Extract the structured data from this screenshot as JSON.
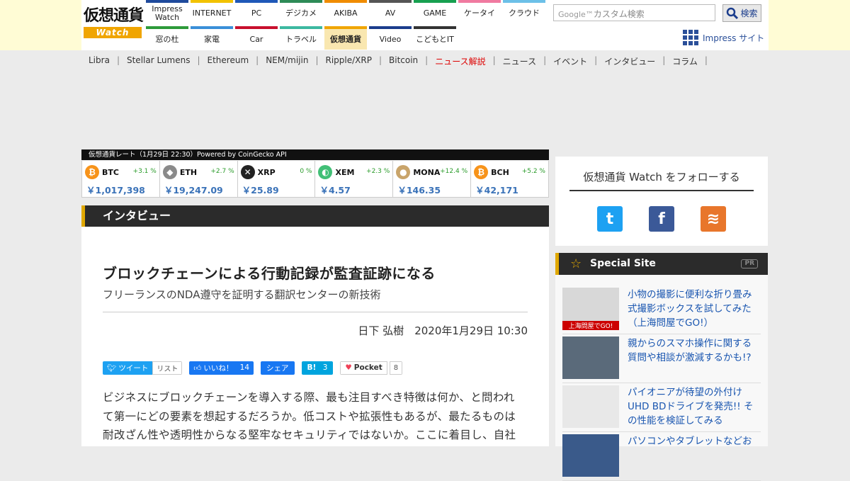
{
  "header": {
    "logo_text": "仮想通貨",
    "logo_sub": "Watch",
    "nav_row1": [
      {
        "label": "Impress Watch",
        "color": "#1f4a9c"
      },
      {
        "label": "INTERNET",
        "color": "#f2c200"
      },
      {
        "label": "PC",
        "color": "#1f58b8"
      },
      {
        "label": "デジカメ",
        "color": "#2e8b57"
      },
      {
        "label": "AKIBA",
        "color": "#f08c00"
      },
      {
        "label": "AV",
        "color": "#555555"
      },
      {
        "label": "GAME",
        "color": "#17a050"
      },
      {
        "label": "ケータイ",
        "color": "#f07aa0"
      },
      {
        "label": "クラウド",
        "color": "#6cc0e8"
      }
    ],
    "nav_row2": [
      {
        "label": "窓の杜",
        "color": "#2e9a3a"
      },
      {
        "label": "家電",
        "color": "#3a8fd8"
      },
      {
        "label": "Car",
        "color": "#c8102e"
      },
      {
        "label": "トラベル",
        "color": "#3cb8a0"
      },
      {
        "label": "仮想通貨",
        "color": "#f0a500",
        "active": true
      },
      {
        "label": "Video",
        "color": "#1a3c8c"
      },
      {
        "label": "こどもとIT",
        "color": "#333333"
      }
    ],
    "search_placeholder": "カスタム検索",
    "search_brand": "Google™",
    "search_button": "検索",
    "impress_site": "Impress サイト"
  },
  "subnav": [
    {
      "label": "Libra"
    },
    {
      "label": "Stellar Lumens"
    },
    {
      "label": "Ethereum"
    },
    {
      "label": "NEM/mijin"
    },
    {
      "label": "Ripple/XRP"
    },
    {
      "label": "Bitcoin"
    },
    {
      "label": "ニュース解説",
      "highlight": true
    },
    {
      "label": "ニュース"
    },
    {
      "label": "イベント"
    },
    {
      "label": "インタビュー"
    },
    {
      "label": "コラム"
    }
  ],
  "rates": {
    "header": "仮想通貨レート（1月29日 22:30）Powered by CoinGecko API",
    "coins": [
      {
        "symbol": "BTC",
        "change": "+3.1 %",
        "price": "￥1,017,398",
        "icon": "bitcoin-icon",
        "color": "#f7931a",
        "glyph": "₿"
      },
      {
        "symbol": "ETH",
        "change": "+2.7 %",
        "price": "￥19,247.09",
        "icon": "ethereum-icon",
        "color": "#8a8a8a",
        "glyph": "◆"
      },
      {
        "symbol": "XRP",
        "change": "0 %",
        "price": "￥25.89",
        "icon": "ripple-icon",
        "color": "#222222",
        "glyph": "✕"
      },
      {
        "symbol": "XEM",
        "change": "+2.3 %",
        "price": "￥4.57",
        "icon": "nem-icon",
        "color": "#41bf76",
        "glyph": "◐"
      },
      {
        "symbol": "MONA",
        "change": "+12.4 %",
        "price": "￥146.35",
        "icon": "monacoin-icon",
        "color": "#c9a46a",
        "glyph": "●"
      },
      {
        "symbol": "BCH",
        "change": "+5.2 %",
        "price": "￥42,171",
        "icon": "bitcoin-cash-icon",
        "color": "#f7931a",
        "glyph": "₿"
      }
    ]
  },
  "article": {
    "category": "インタビュー",
    "title": "ブロックチェーンによる行動記録が監査証跡になる",
    "subtitle": "フリーランスのNDA遵守を証明する翻訳センターの新技術",
    "author": "日下 弘樹",
    "date": "2020年1月29日 10:30",
    "share": {
      "tweet": "ツイート",
      "list": "リスト",
      "like": "いいね！",
      "like_count": "14",
      "fb_share": "シェア",
      "hatena": "B!",
      "hatena_count": "3",
      "pocket": "Pocket",
      "pocket_count": "8"
    },
    "body_lines": [
      "ビジネスにブロックチェーンを導入する際、最も注目すべき特徴は何か、と問われ",
      "て第一にどの要素を想起するだろうか。低コストや拡張性もあるが、最たるものは",
      "耐改ざん性や透明性からなる堅牢なセキュリティではないか。ここに着目し、自社"
    ]
  },
  "sidebar": {
    "follow_title": "仮想通貨 Watch をフォローする",
    "social": [
      {
        "icon": "twitter-icon",
        "color": "#1da1f2",
        "glyph": "t"
      },
      {
        "icon": "facebook-icon",
        "color": "#3b5998",
        "glyph": "f"
      },
      {
        "icon": "rss-icon",
        "color": "#e8762b",
        "glyph": "≋"
      }
    ],
    "special_title": "Special Site",
    "special_pr": "PR",
    "special_items": [
      {
        "text": "小物の撮影に便利な折り畳み式撮影ボックスを試してみた（上海問屋でGO!）",
        "thumb_color": "#d8d8d8",
        "thumb_label": "上海問屋でGO!"
      },
      {
        "text": "親からのスマホ操作に関する質問や相談が激減するかも!?",
        "thumb_color": "#5a6a7a",
        "thumb_label": ""
      },
      {
        "text": "パイオニアが待望の外付けUHD BDドライブを発売!! その性能を検証してみる",
        "thumb_color": "#e8e8e8",
        "thumb_label": ""
      },
      {
        "text": "パソコンやタブレットなどお",
        "thumb_color": "#3a5a8a",
        "thumb_label": ""
      }
    ]
  }
}
